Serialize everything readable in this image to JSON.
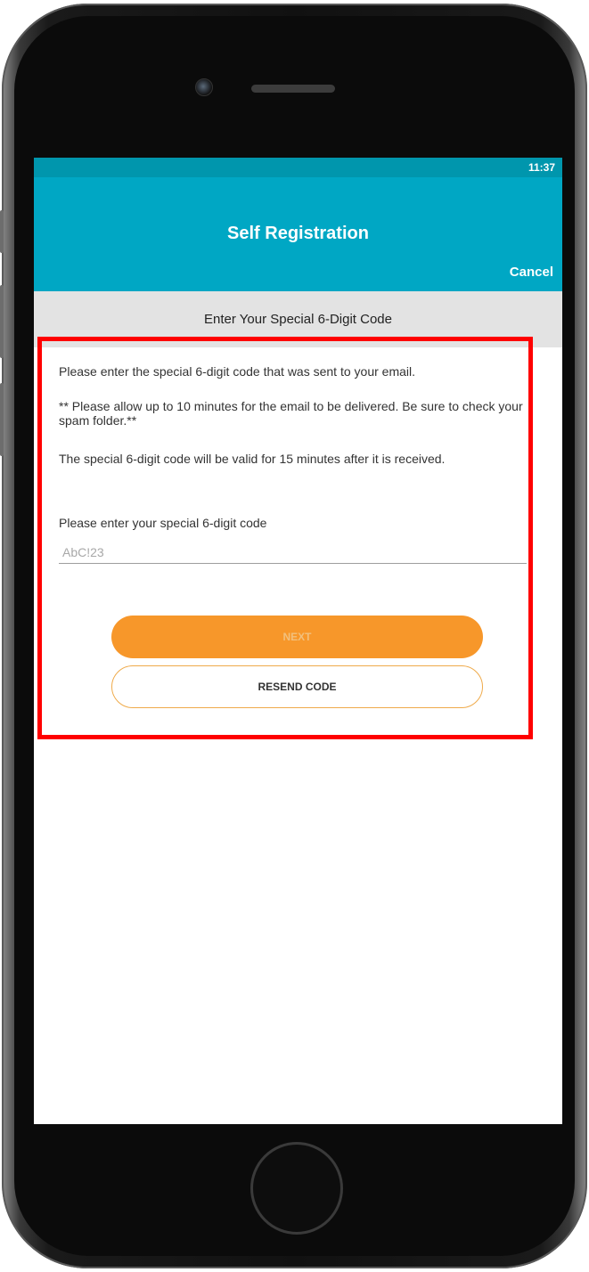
{
  "status_bar": {
    "time": "11:37"
  },
  "app_bar": {
    "title": "Self Registration",
    "cancel_label": "Cancel"
  },
  "subheader": {
    "title": "Enter Your Special 6-Digit Code"
  },
  "instructions": {
    "line1": "Please enter the special 6-digit code that was sent to your email.",
    "line2": "** Please allow up to 10 minutes for the email to be delivered. Be sure to check your spam folder.**",
    "line3": "The special 6-digit code will be valid for 15 minutes after it is received."
  },
  "code_field": {
    "label": "Please enter your special 6-digit code",
    "placeholder": "AbC!23",
    "value": ""
  },
  "buttons": {
    "next_label": "NEXT",
    "resend_label": "RESEND CODE"
  },
  "colors": {
    "app_bar": "#00a7c4",
    "status_bar": "#0096ad",
    "primary_button": "#f7972a",
    "highlight": "#ff0000"
  }
}
